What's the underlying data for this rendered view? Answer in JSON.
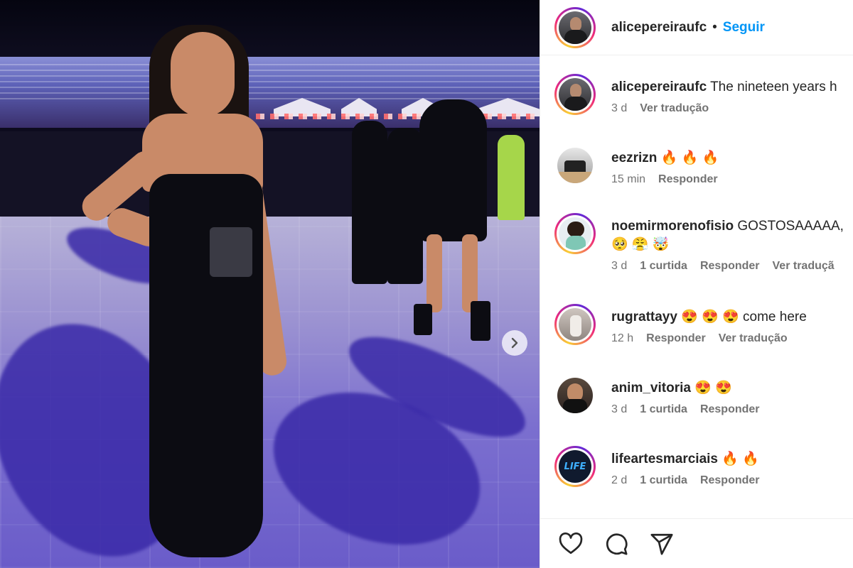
{
  "post": {
    "username": "alicepereiraufc",
    "separator": "•",
    "follow_label": "Seguir",
    "caption": "The nineteen years h",
    "caption_age": "3 d",
    "caption_translate": "Ver tradução"
  },
  "comments": [
    {
      "username": "eezrizn",
      "text": "🔥 🔥 🔥",
      "age": "15 min",
      "likes": "",
      "reply": "Responder",
      "translate": ""
    },
    {
      "username": "noemirmorenofisio",
      "text": "GOSTOSAAAAA,",
      "text_line2": "🥺 😤 🤯",
      "age": "3 d",
      "likes": "1 curtida",
      "reply": "Responder",
      "translate": "Ver traduçã"
    },
    {
      "username": "rugrattayy",
      "text": "😍 😍 😍 come here",
      "age": "12 h",
      "likes": "",
      "reply": "Responder",
      "translate": "Ver tradução"
    },
    {
      "username": "anim_vitoria",
      "text": "😍 😍",
      "age": "3 d",
      "likes": "1 curtida",
      "reply": "Responder",
      "translate": ""
    },
    {
      "username": "lifeartesmarciais",
      "text": "🔥 🔥",
      "age": "2 d",
      "likes": "1 curtida",
      "reply": "Responder",
      "translate": ""
    }
  ],
  "avatars": {
    "life_logo": "LIFE"
  },
  "actions": {
    "like": "heart-icon",
    "comment": "comment-icon",
    "share": "share-icon"
  },
  "colors": {
    "accent": "#0095f6",
    "meta": "#737373",
    "text": "#262626"
  }
}
